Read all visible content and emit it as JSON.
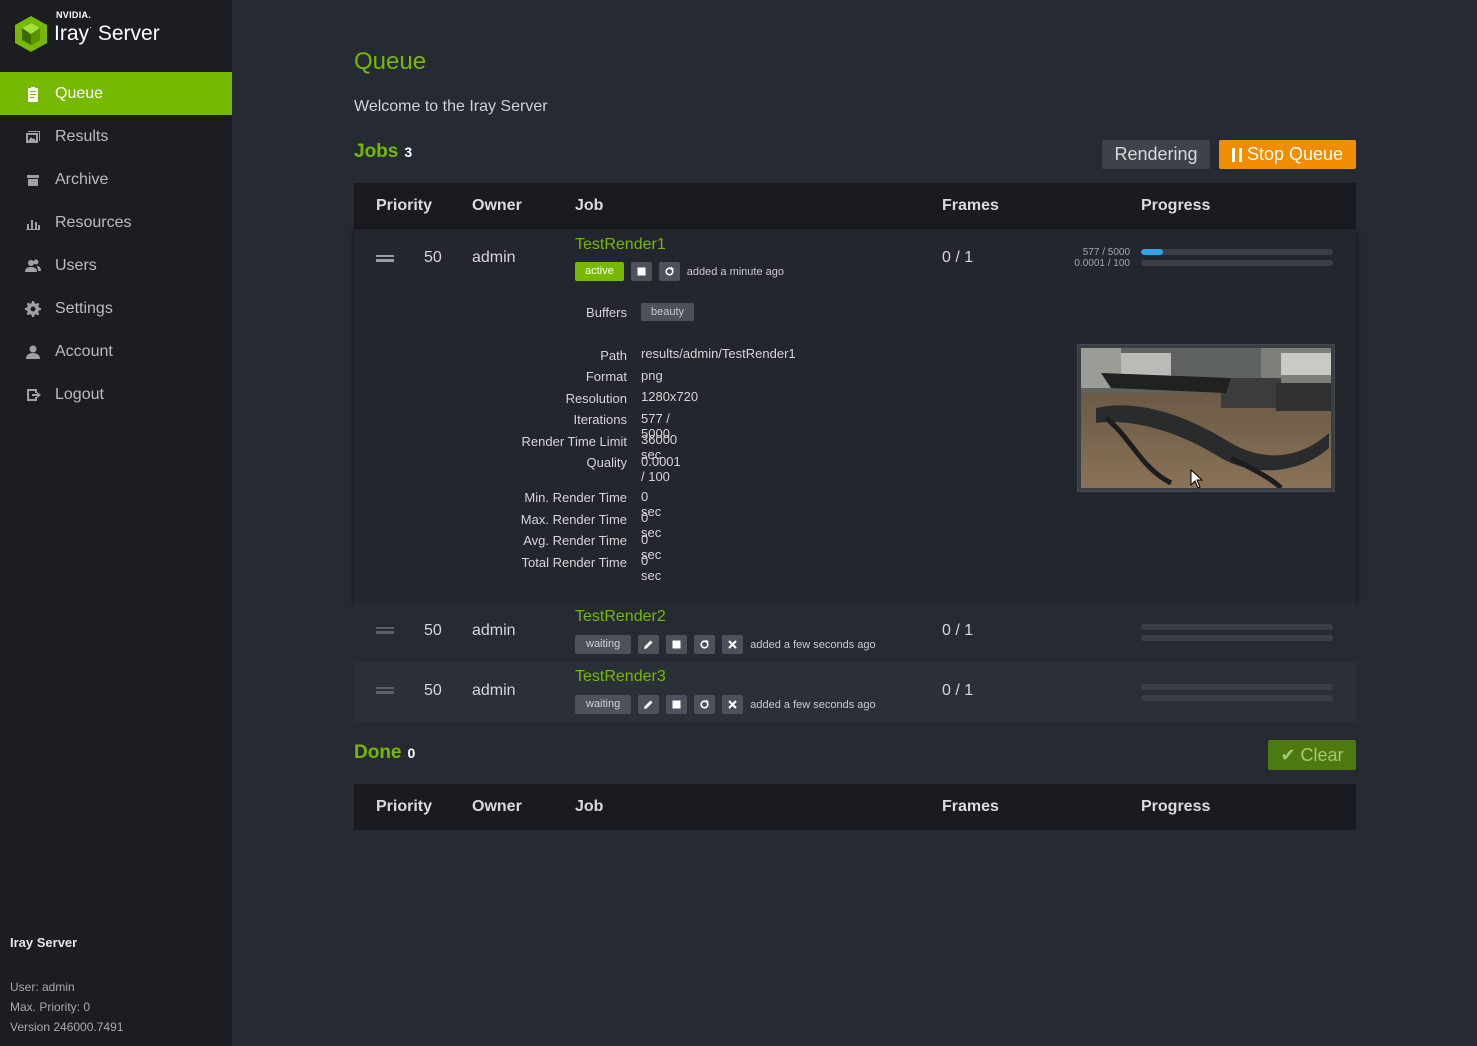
{
  "app": {
    "brand_small": "NVIDIA.",
    "product": "Iray",
    "product_suffix": "Server"
  },
  "sidebar": {
    "items": [
      {
        "label": "Queue",
        "icon": "clipboard-icon",
        "active": true
      },
      {
        "label": "Results",
        "icon": "images-icon",
        "active": false
      },
      {
        "label": "Archive",
        "icon": "archive-box-icon",
        "active": false
      },
      {
        "label": "Resources",
        "icon": "bar-chart-icon",
        "active": false
      },
      {
        "label": "Users",
        "icon": "users-icon",
        "active": false
      },
      {
        "label": "Settings",
        "icon": "gear-icon",
        "active": false
      },
      {
        "label": "Account",
        "icon": "user-icon",
        "active": false
      },
      {
        "label": "Logout",
        "icon": "logout-icon",
        "active": false
      }
    ],
    "footer": {
      "title": "Iray Server",
      "user": "User: admin",
      "max_priority": "Max. Priority: 0",
      "version": "Version 246000.7491"
    }
  },
  "main": {
    "title": "Queue",
    "welcome": "Welcome to the Iray Server",
    "jobs_label": "Jobs",
    "jobs_count": "3",
    "rendering_label": "Rendering",
    "stop_queue_label": "Stop Queue",
    "done_label": "Done",
    "done_count": "0",
    "clear_label": "Clear",
    "columns": [
      "Priority",
      "Owner",
      "Job",
      "Frames",
      "Progress"
    ]
  },
  "jobs": [
    {
      "priority": "50",
      "owner": "admin",
      "name": "TestRender1",
      "status": "active",
      "added": "added a minute ago",
      "frames": "0 / 1",
      "iter_progress_text": "577 / 5000",
      "quality_progress_text": "0.0001 / 100",
      "iter_progress": 0.1154,
      "quality_progress": 1e-06,
      "details": {
        "buffers_label": "Buffers",
        "buffers": "beauty",
        "path_label": "Path",
        "path": "results/admin/TestRender1",
        "format_label": "Format",
        "format": "png",
        "resolution_label": "Resolution",
        "resolution": "1280x720",
        "iterations_label": "Iterations",
        "iterations": "577 / 5000",
        "time_limit_label": "Render Time Limit",
        "time_limit": "36000 sec",
        "quality_label": "Quality",
        "quality": "0.0001 / 100",
        "min_label": "Min. Render Time",
        "min": "0 sec",
        "max_label": "Max. Render Time",
        "max": "0 sec",
        "avg_label": "Avg. Render Time",
        "avg": "0 sec",
        "total_label": "Total Render Time",
        "total": "0 sec"
      }
    },
    {
      "priority": "50",
      "owner": "admin",
      "name": "TestRender2",
      "status": "waiting",
      "added": "added a few seconds ago",
      "frames": "0 / 1",
      "iter_progress": 0,
      "quality_progress": 0
    },
    {
      "priority": "50",
      "owner": "admin",
      "name": "TestRender3",
      "status": "waiting",
      "added": "added a few seconds ago",
      "frames": "0 / 1",
      "iter_progress": 0,
      "quality_progress": 0
    }
  ],
  "colors": {
    "accent": "#76b900",
    "warning": "#f28c00",
    "progress": "#2fa3e6",
    "sidebar_bg": "#1b1d22",
    "page_bg": "#262a33"
  }
}
